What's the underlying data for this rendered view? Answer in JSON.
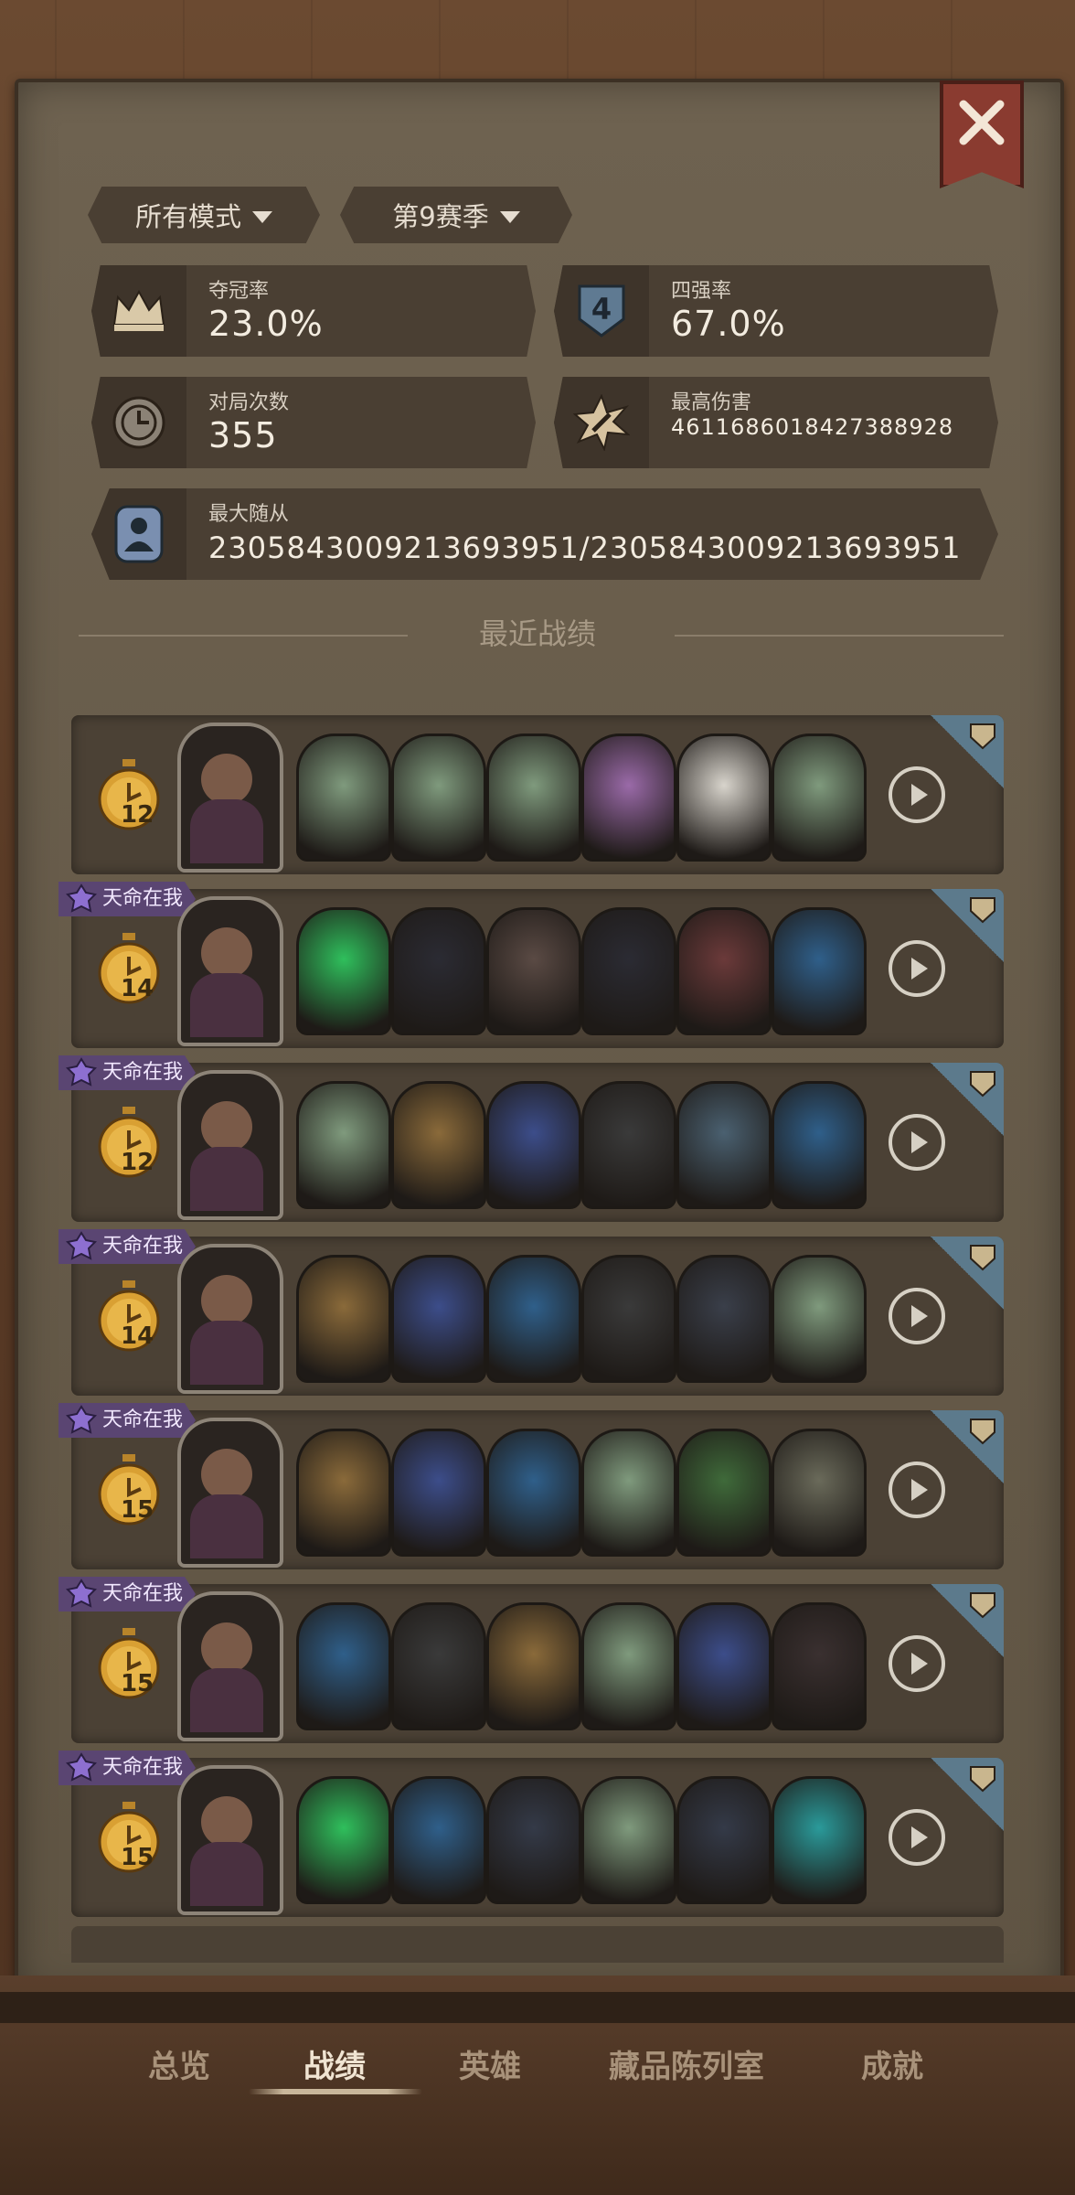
{
  "filters": {
    "mode": "所有模式",
    "season": "第9赛季"
  },
  "stats": {
    "win_rate": {
      "label": "夺冠率",
      "value": "23.0%"
    },
    "top4_rate": {
      "label": "四强率",
      "value": "67.0%"
    },
    "games": {
      "label": "对局次数",
      "value": "355"
    },
    "max_damage": {
      "label": "最高伤害",
      "value": "4611686018427388928"
    },
    "max_minions": {
      "label": "最大随从",
      "value": "2305843009213693951/2305843009213693951"
    }
  },
  "section_title": "最近战绩",
  "matches": [
    {
      "turn": "12",
      "fate": "",
      "units": [
        "#7f9a7d",
        "#7f9a7d",
        "#7f9a7d",
        "#9a6aa8",
        "#d8d4cc",
        "#7f9a7d"
      ]
    },
    {
      "turn": "14",
      "fate": "天命在我",
      "units": [
        "#2fbf5c",
        "#2b2b33",
        "#5a4a44",
        "#2b2b33",
        "#6b3a3a",
        "#2f5f8a"
      ]
    },
    {
      "turn": "12",
      "fate": "天命在我",
      "units": [
        "#7f9a7d",
        "#8a6a3a",
        "#3c4d8a",
        "#3a3a3a",
        "#4a6070",
        "#2f5f8a"
      ]
    },
    {
      "turn": "14",
      "fate": "天命在我",
      "units": [
        "#8a6a3a",
        "#3c4d8a",
        "#2f5f8a",
        "#3a3a3a",
        "#3a3f4a",
        "#7f9a7d"
      ]
    },
    {
      "turn": "15",
      "fate": "天命在我",
      "units": [
        "#8a6a3a",
        "#3c4d8a",
        "#2f5f8a",
        "#7f9a7d",
        "#3f6a3a",
        "#6a6a5a"
      ]
    },
    {
      "turn": "15",
      "fate": "天命在我",
      "units": [
        "#2f5f8a",
        "#3a3a3a",
        "#8a6a3a",
        "#7f9a7d",
        "#3c4d8a",
        "#3a3030"
      ]
    },
    {
      "turn": "15",
      "fate": "天命在我",
      "units": [
        "#2fbf5c",
        "#2f5f8a",
        "#343a48",
        "#7f9a7d",
        "#343a48",
        "#2a9a9a"
      ]
    }
  ],
  "tabs": [
    "总览",
    "战绩",
    "英雄",
    "藏品陈列室",
    "成就"
  ],
  "active_tab": "战绩",
  "colors": {
    "accent": "#f0e4d2",
    "fate_badge": "#5a4572",
    "panel": "#5f5443"
  }
}
